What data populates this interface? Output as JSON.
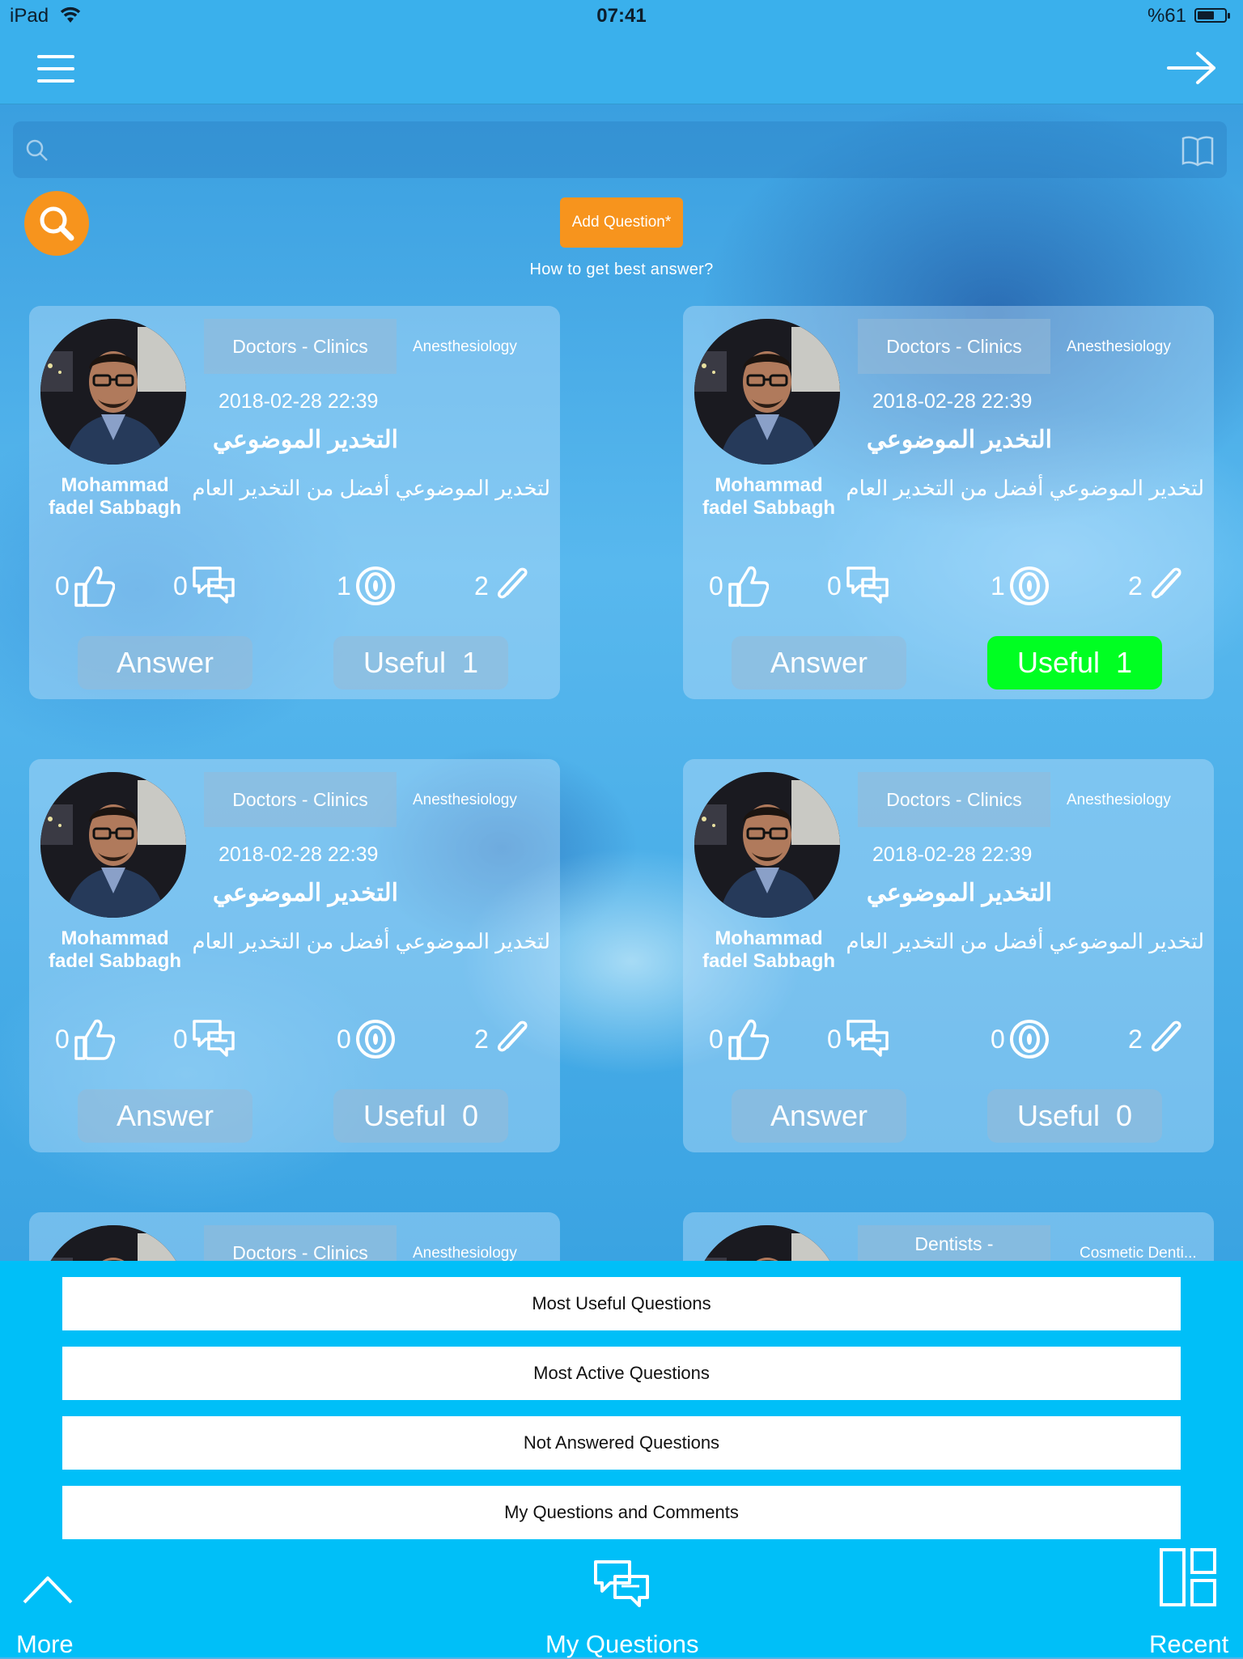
{
  "status_bar": {
    "carrier": "iPad",
    "time": "07:41",
    "battery_percent": "%61",
    "battery_level": 0.61
  },
  "nav": {
    "menu_icon": "hamburger-menu-icon",
    "forward_icon": "arrow-right-icon"
  },
  "search": {
    "placeholder": "",
    "search_icon": "search-icon",
    "book_icon": "book-icon"
  },
  "actions": {
    "add_question_label": "Add Question*",
    "how_to_label": "How to get best answer?"
  },
  "questions": [
    {
      "author_line1": "Mohammad",
      "author_line2": "fadel Sabbagh",
      "category": "Doctors - Clinics",
      "subcategory": "Anesthesiology",
      "date": "2018-02-28 22:39",
      "title": "التخدير الموضوعي",
      "body": "لتخدير الموضوعي أفضل من التخدير العام",
      "likes": "0",
      "comments": "0",
      "views": "1",
      "attachments": "2",
      "answer_label": "Answer",
      "useful_label": "Useful",
      "useful_count": "1",
      "useful_active": false
    },
    {
      "author_line1": "Mohammad",
      "author_line2": "fadel Sabbagh",
      "category": "Doctors - Clinics",
      "subcategory": "Anesthesiology",
      "date": "2018-02-28 22:39",
      "title": "التخدير الموضوعي",
      "body": "لتخدير الموضوعي أفضل من التخدير العام",
      "likes": "0",
      "comments": "0",
      "views": "1",
      "attachments": "2",
      "answer_label": "Answer",
      "useful_label": "Useful",
      "useful_count": "1",
      "useful_active": true
    },
    {
      "author_line1": "Mohammad",
      "author_line2": "fadel Sabbagh",
      "category": "Doctors - Clinics",
      "subcategory": "Anesthesiology",
      "date": "2018-02-28 22:39",
      "title": "التخدير الموضوعي",
      "body": "لتخدير الموضوعي أفضل من التخدير العام",
      "likes": "0",
      "comments": "0",
      "views": "0",
      "attachments": "2",
      "answer_label": "Answer",
      "useful_label": "Useful",
      "useful_count": "0",
      "useful_active": false
    },
    {
      "author_line1": "Mohammad",
      "author_line2": "fadel Sabbagh",
      "category": "Doctors - Clinics",
      "subcategory": "Anesthesiology",
      "date": "2018-02-28 22:39",
      "title": "التخدير الموضوعي",
      "body": "لتخدير الموضوعي أفضل من التخدير العام",
      "likes": "0",
      "comments": "0",
      "views": "0",
      "attachments": "2",
      "answer_label": "Answer",
      "useful_label": "Useful",
      "useful_count": "0",
      "useful_active": false
    },
    {
      "category": "Doctors - Clinics",
      "subcategory": "Anesthesiology"
    },
    {
      "category": "Dentists -",
      "subcategory": "Cosmetic Denti..."
    }
  ],
  "filters": [
    "Most Useful Questions",
    "Most Active Questions",
    "Not Answered Questions",
    "My Questions and Comments"
  ],
  "tabs": {
    "more": "More",
    "my_questions": "My Questions",
    "recent": "Recent"
  },
  "colors": {
    "bar": "#3ab0ec",
    "panel": "#00bff8",
    "accent_orange": "#f7941d",
    "useful_active": "#00ff22"
  }
}
